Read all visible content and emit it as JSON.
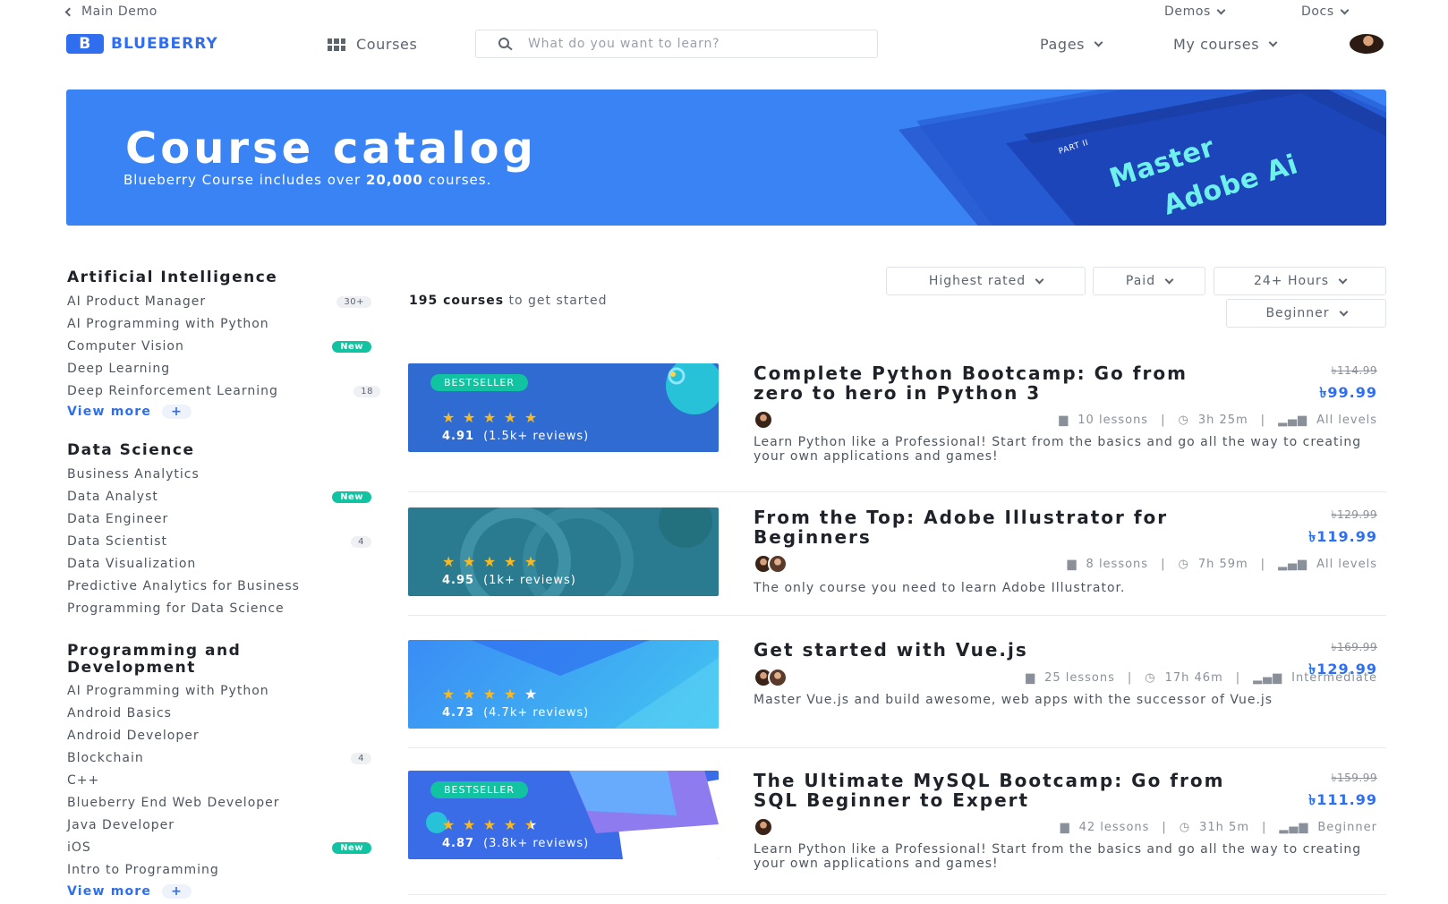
{
  "topbar": {
    "back_label": "Main Demo",
    "demos_label": "Demos",
    "docs_label": "Docs"
  },
  "nav": {
    "logo_letter": "B",
    "logo_text": "BLUEBERRY",
    "courses_label": "Courses",
    "search_placeholder": "What do you want to learn?",
    "pages_label": "Pages",
    "my_courses_label": "My courses"
  },
  "hero": {
    "title": "Course catalog",
    "subtitle_pre": "Blueberry Course includes over ",
    "subtitle_bold": "20,000",
    "subtitle_post": " courses.",
    "book_part": "PART II",
    "book_title_1": "Master",
    "book_title_2": "Adobe Ai"
  },
  "sidebar": {
    "categories": [
      {
        "title": "Artificial Intelligence",
        "items": [
          {
            "label": "AI Product Manager",
            "badge": "30+",
            "badge_type": "count"
          },
          {
            "label": "AI Programming with Python",
            "badge": "",
            "badge_type": ""
          },
          {
            "label": "Computer Vision",
            "badge": "New",
            "badge_type": "new"
          },
          {
            "label": "Deep Learning",
            "badge": "",
            "badge_type": ""
          },
          {
            "label": "Deep Reinforcement Learning",
            "badge": "18",
            "badge_type": "count"
          }
        ],
        "view_more": "View more"
      },
      {
        "title": "Data Science",
        "items": [
          {
            "label": "Business Analytics",
            "badge": "",
            "badge_type": ""
          },
          {
            "label": "Data Analyst",
            "badge": "New",
            "badge_type": "new"
          },
          {
            "label": "Data Engineer",
            "badge": "",
            "badge_type": ""
          },
          {
            "label": "Data Scientist",
            "badge": "4",
            "badge_type": "count"
          },
          {
            "label": "Data Visualization",
            "badge": "",
            "badge_type": ""
          },
          {
            "label": "Predictive Analytics for Business",
            "badge": "",
            "badge_type": ""
          },
          {
            "label": "Programming for Data Science",
            "badge": "",
            "badge_type": ""
          }
        ]
      },
      {
        "title": "Programming and Development",
        "items": [
          {
            "label": "AI Programming with Python",
            "badge": "",
            "badge_type": ""
          },
          {
            "label": "Android Basics",
            "badge": "",
            "badge_type": ""
          },
          {
            "label": "Android Developer",
            "badge": "",
            "badge_type": ""
          },
          {
            "label": "Blockchain",
            "badge": "4",
            "badge_type": "count"
          },
          {
            "label": "C++",
            "badge": "",
            "badge_type": ""
          },
          {
            "label": "Blueberry End Web Developer",
            "badge": "",
            "badge_type": ""
          },
          {
            "label": "Java Developer",
            "badge": "",
            "badge_type": ""
          },
          {
            "label": "iOS",
            "badge": "New",
            "badge_type": "new"
          },
          {
            "label": "Intro to Programming",
            "badge": "",
            "badge_type": ""
          }
        ],
        "view_more": "View more"
      }
    ]
  },
  "results": {
    "count_bold": "195 courses",
    "count_rest": " to get started",
    "filters": {
      "sort": "Highest rated",
      "price": "Paid",
      "duration": "24+ Hours",
      "level": "Beginner"
    }
  },
  "courses": [
    {
      "title": "Complete Python Bootcamp: Go from zero to hero in Python 3",
      "old_price": "৳114.99",
      "price": "৳99.99",
      "lessons": "10 lessons",
      "duration": "3h 25m",
      "level": "All levels",
      "description": "Learn Python like a Professional! Start from the basics and go all the way to creating your own applications and games!",
      "bestseller": "BESTSELLER",
      "rating": "4.91",
      "reviews": "(1.5k+ reviews)",
      "stars": 5
    },
    {
      "title": "From the Top: Adobe Illustrator for Beginners",
      "old_price": "৳129.99",
      "price": "৳119.99",
      "lessons": "8 lessons",
      "duration": "7h 59m",
      "level": "All levels",
      "description": "The only course you need to learn Adobe Illustrator.",
      "bestseller": "",
      "rating": "4.95",
      "reviews": "(1k+ reviews)",
      "stars": 5
    },
    {
      "title": "Get started with Vue.js",
      "old_price": "৳169.99",
      "price": "৳129.99",
      "lessons": "25 lessons",
      "duration": "17h 46m",
      "level": "Intermediate",
      "description": "Master Vue.js and build awesome, web apps with the successor of Vue.js",
      "bestseller": "",
      "rating": "4.73",
      "reviews": "(4.7k+ reviews)",
      "stars": 4
    },
    {
      "title": "The Ultimate MySQL Bootcamp: Go from SQL Beginner to Expert",
      "old_price": "৳159.99",
      "price": "৳111.99",
      "lessons": "42 lessons",
      "duration": "31h 5m",
      "level": "Beginner",
      "description": "Learn Python like a Professional! Start from the basics and go all the way to creating your own applications and games!",
      "bestseller": "BESTSELLER",
      "rating": "4.87",
      "reviews": "(3.8k+ reviews)",
      "stars": 4.5
    }
  ],
  "colors": {
    "brand": "#2f6fef",
    "hero": "#3a83f5",
    "new_badge": "#11c3a0",
    "star": "#f7b924"
  }
}
